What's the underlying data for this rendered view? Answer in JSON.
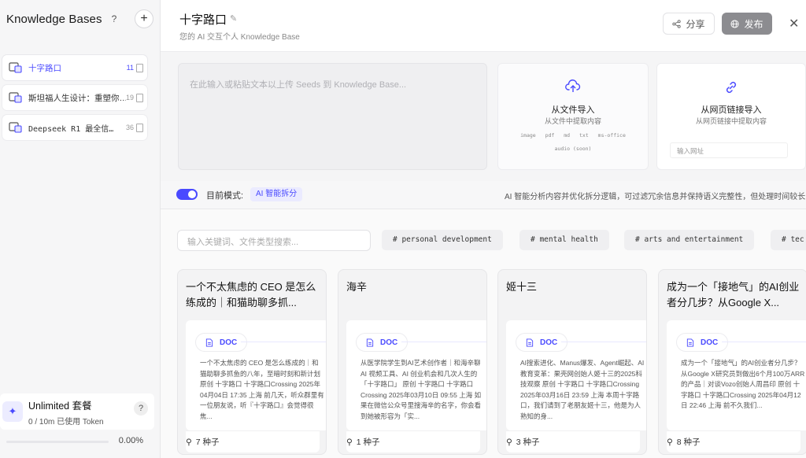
{
  "sidebar": {
    "title": "Knowledge Bases",
    "help": "?",
    "add": "+",
    "items": [
      {
        "name": "十字路口",
        "count": "11"
      },
      {
        "name": "斯坦福人生设计：重塑你…",
        "count": "19"
      },
      {
        "name": "Deepseek R1 最全信…",
        "count": "36"
      }
    ],
    "plan": {
      "title": "Unlimited 套餐",
      "usage": "0 / 10m 已使用 Token",
      "help": "?",
      "progress_value": 0.0,
      "progress_text": "0.00%"
    }
  },
  "header": {
    "title": "十字路口",
    "subtitle": "您的 AI 交互个人 Knowledge Base",
    "share_label": "分享",
    "publish_label": "发布"
  },
  "seed": {
    "placeholder": "在此输入或粘贴文本以上传 Seeds 到 Knowledge Base..."
  },
  "file_import": {
    "title": "从文件导入",
    "subtitle": "从文件中提取内容",
    "formats": "image pdf md txt ms-office",
    "formats2": "audio (soon)"
  },
  "web_import": {
    "title": "从网页链接导入",
    "subtitle": "从网页链接中提取内容",
    "placeholder": "输入网址"
  },
  "mode": {
    "label": "目前模式:",
    "chip": "AI 智能拆分",
    "description": "AI 智能分析内容并优化拆分逻辑，可过滤冗余信息并保持语义完整性，但处理时间较长"
  },
  "search": {
    "placeholder": "输入关键词、文件类型搜索..."
  },
  "tags": [
    "# personal development",
    "# mental health",
    "# arts and entertainment",
    "# tec"
  ],
  "cards": [
    {
      "title": "一个不太焦虑的 CEO 是怎么练成的｜和猫助聊多抓...",
      "badge": "DOC",
      "text": "一个不太焦虑的 CEO 是怎么练成的｜和猫助聊多抓鱼的八年，至暗时刻和新计划 原创 十字路口 十字路口Crossing 2025年04月04日 17:35 上海 前几天，听众群里有一位朋友说，听『十字路口』会觉得很焦...",
      "seeds": "7 种子"
    },
    {
      "title": "海辛",
      "badge": "DOC",
      "text": "从医学院学生到AI艺术创作者｜和海辛聊 AI 视频工具、AI 创业机会和几次人生的「十字路口」 原创 十字路口 十字路口Crossing 2025年03月10日 09:55 上海 如果在微信公众号里搜海辛的名字，你会看到她被形容为「实...",
      "seeds": "1 种子"
    },
    {
      "title": "姬十三",
      "badge": "DOC",
      "text": "AI搜索进化、Manus爆发、Agent崛起、AI教育变革：果壳网创始人姬十三的2025科技观察 原创 十字路口 十字路口Crossing 2025年03月16日 23:59 上海 本周十字路口，我们请到了老朋友姬十三，他是为人熟知的身...",
      "seeds": "3 种子"
    },
    {
      "title": "成为一个「接地气」的AI创业者分几步？从Google X...",
      "badge": "DOC",
      "text": "成为一个「接地气」的AI创业者分几步？从Google X研究员到做出6个月100万ARR的产品｜对谈Vozo创始人周昌印 原创 十字路口 十字路口Crossing 2025年04月12日 22:46 上海 前不久我们...",
      "seeds": "8 种子"
    }
  ],
  "colors": {
    "accent": "#4a4aff",
    "publish_bg": "#8c8c90"
  }
}
